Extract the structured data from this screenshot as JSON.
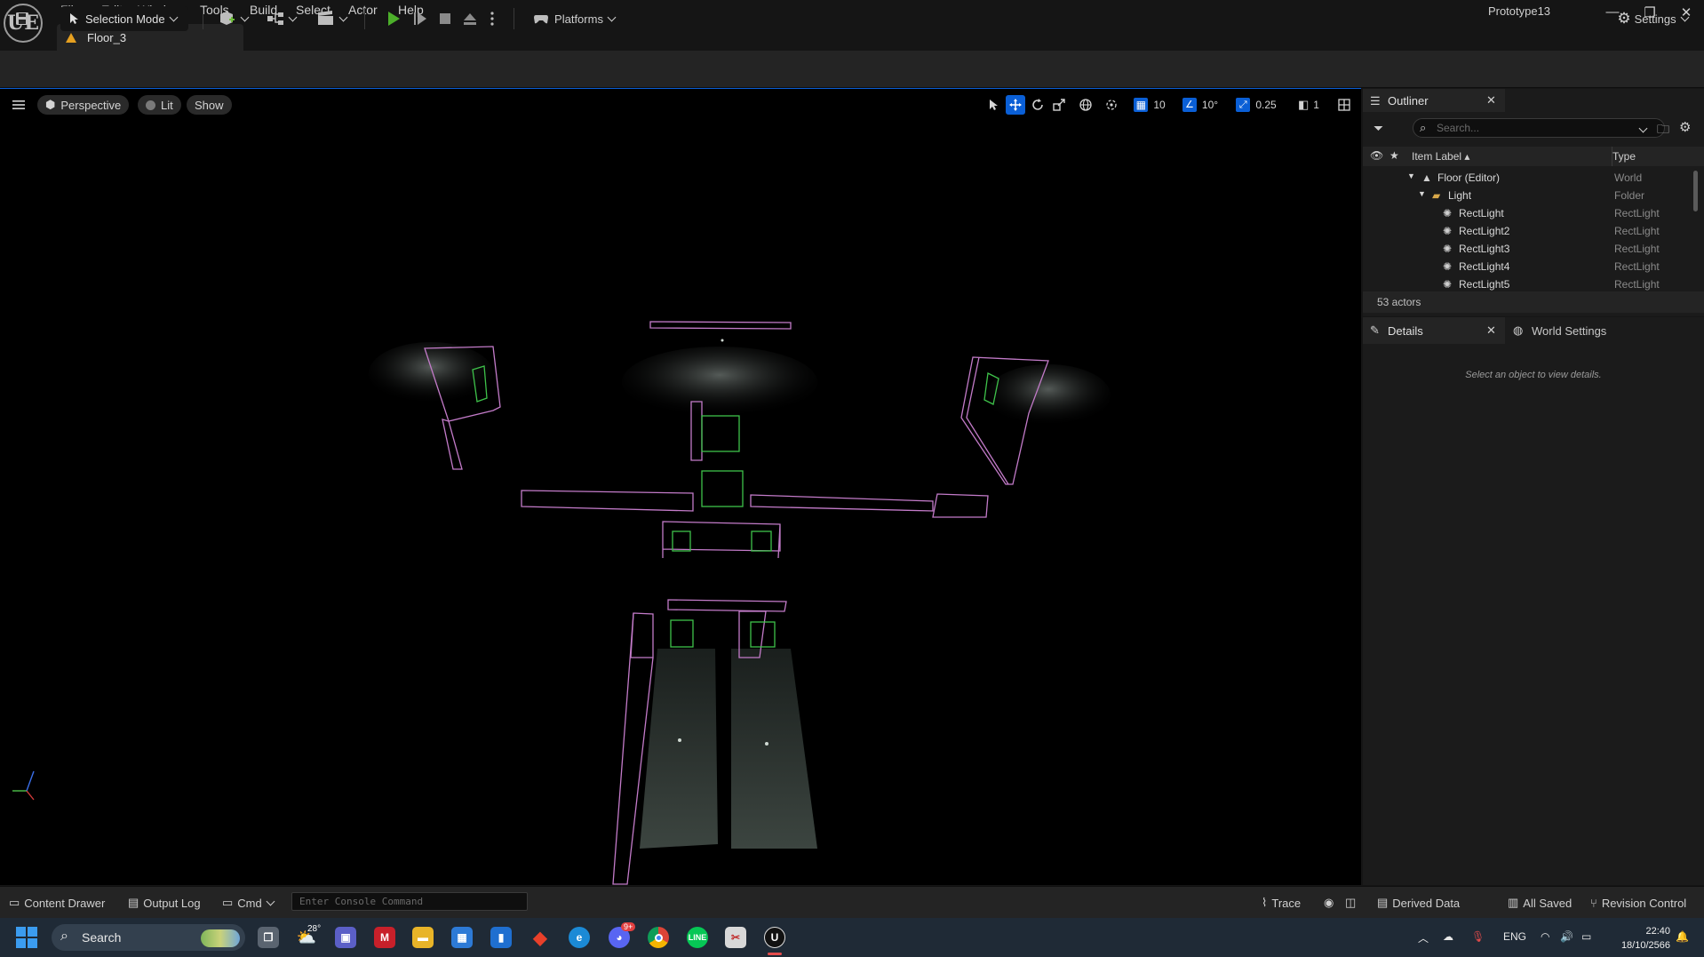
{
  "window": {
    "logo": "UE",
    "project_name": "Prototype13",
    "level_tab": "Floor_3",
    "minimize_icon": "—",
    "restore_icon": "❐",
    "close_icon": "✕"
  },
  "menu": [
    "File",
    "Edit",
    "Window",
    "Tools",
    "Build",
    "Select",
    "Actor",
    "Help"
  ],
  "toolbar": {
    "mode": "Selection Mode",
    "platforms": "Platforms",
    "settings": "Settings",
    "icons": [
      "save-icon",
      "add-actor-icon",
      "blueprint-icon",
      "cinematics-icon",
      "play-icon",
      "advance-frame-icon",
      "stop-icon",
      "eject-icon",
      "more-options-icon"
    ]
  },
  "viewport": {
    "view_mode": "Perspective",
    "lighting": "Lit",
    "show": "Show",
    "grid_snap": "10",
    "rotation_snap": "10°",
    "scale_snap": "0.25",
    "camera_speed": "1"
  },
  "outliner": {
    "tab": "Outliner",
    "search_placeholder": "Search...",
    "columns": {
      "label": "Item Label ▴",
      "type": "Type"
    },
    "rows": [
      {
        "label": "Floor (Editor)",
        "type": "World",
        "indent": 1,
        "kind": "world"
      },
      {
        "label": "Light",
        "type": "Folder",
        "indent": 2,
        "kind": "folder"
      },
      {
        "label": "RectLight",
        "type": "RectLight",
        "indent": 3,
        "kind": "light"
      },
      {
        "label": "RectLight2",
        "type": "RectLight",
        "indent": 3,
        "kind": "light"
      },
      {
        "label": "RectLight3",
        "type": "RectLight",
        "indent": 3,
        "kind": "light"
      },
      {
        "label": "RectLight4",
        "type": "RectLight",
        "indent": 3,
        "kind": "light"
      },
      {
        "label": "RectLight5",
        "type": "RectLight",
        "indent": 3,
        "kind": "light"
      }
    ],
    "actor_count": "53 actors"
  },
  "details": {
    "tab": "Details",
    "world_settings_tab": "World Settings",
    "empty_message": "Select an object to view details."
  },
  "statusbar": {
    "content_drawer": "Content Drawer",
    "output_log": "Output Log",
    "cmd": "Cmd",
    "console_placeholder": "Enter Console Command",
    "trace": "Trace",
    "derived_data": "Derived Data",
    "all_saved": "All Saved",
    "revision_control": "Revision Control"
  },
  "taskbar": {
    "search": "Search",
    "weather": "28°",
    "language": "ENG",
    "time": "22:40",
    "date": "18/10/2566",
    "notification_badge": "9+"
  },
  "colors": {
    "accent": "#0a5fd6",
    "play_green": "#4caf2a",
    "wire_pink": "#c37bc9",
    "wire_green": "#3ec24a"
  }
}
